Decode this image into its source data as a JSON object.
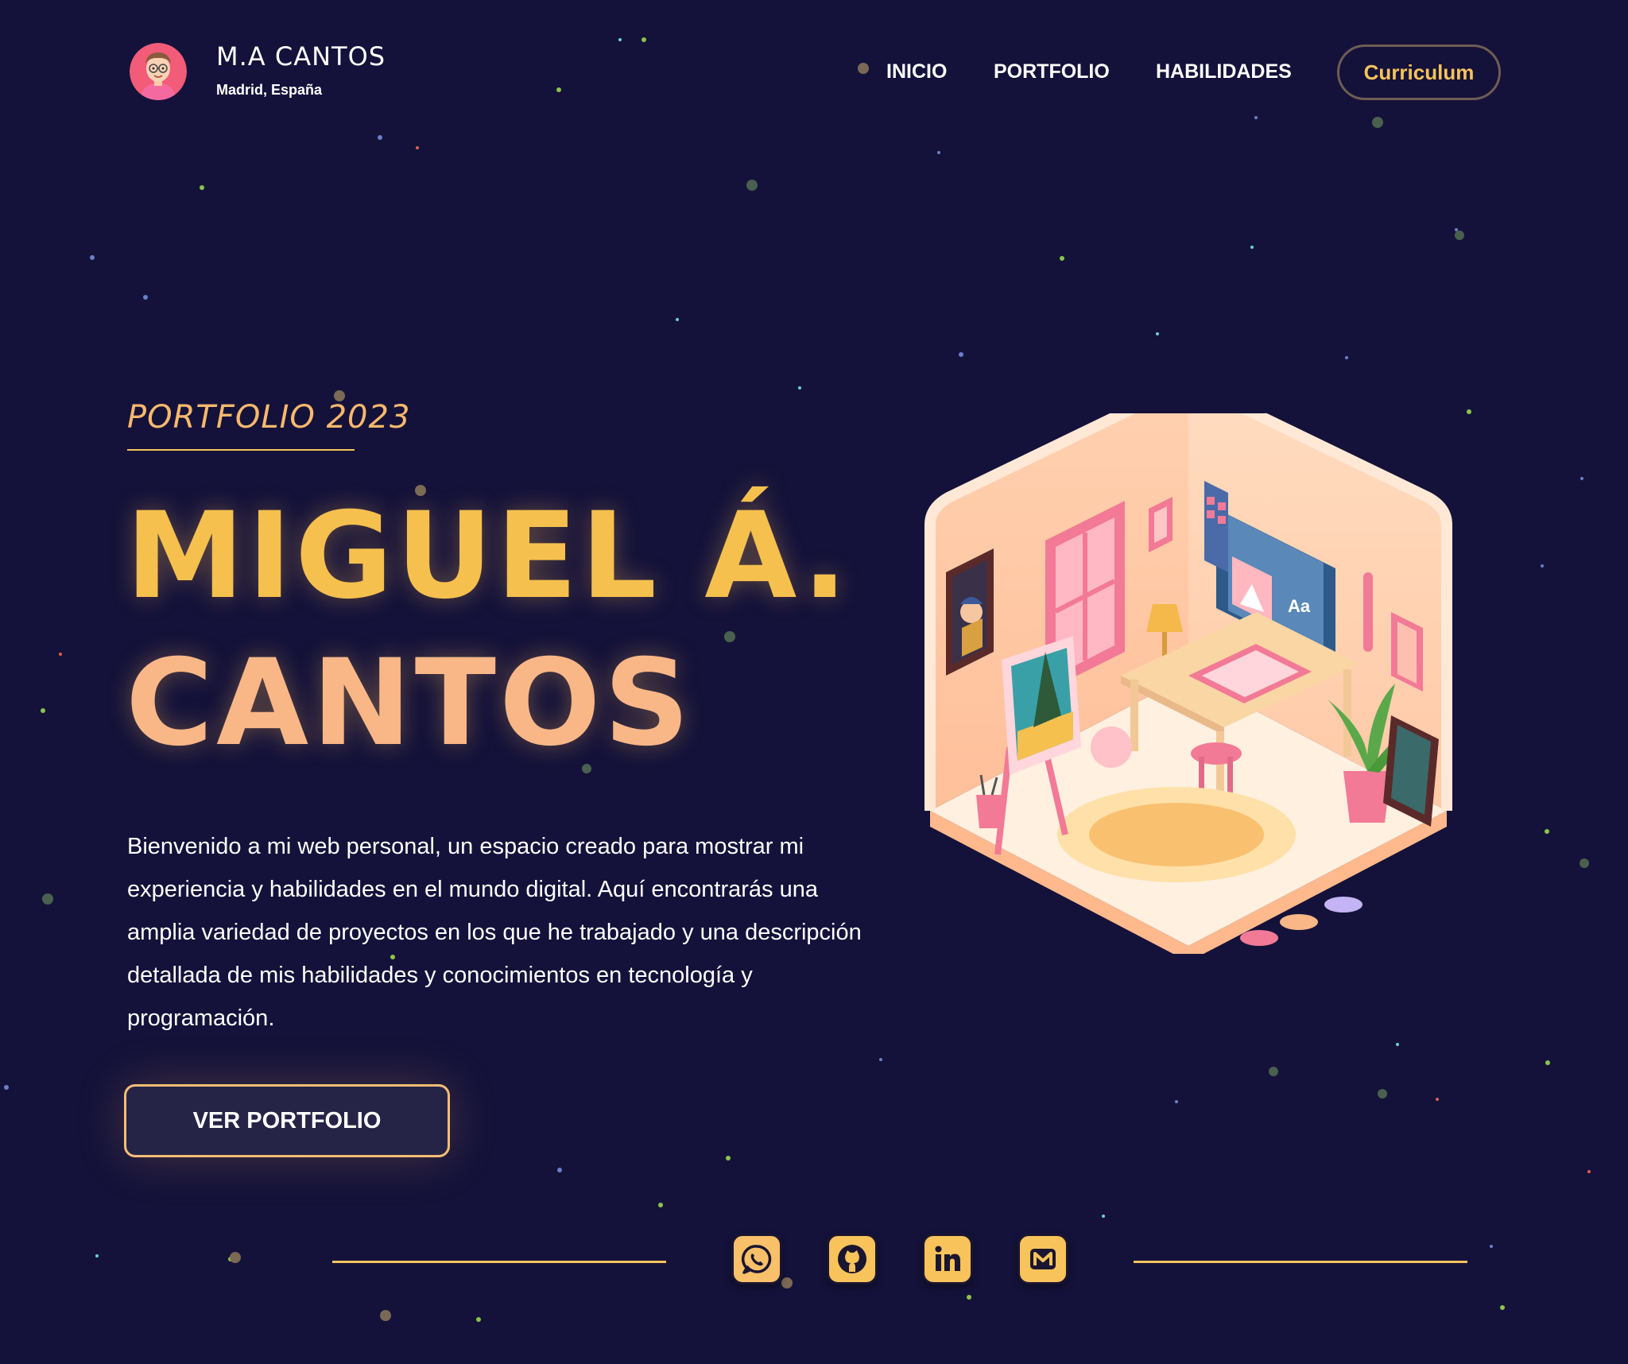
{
  "header": {
    "brand_name": "M.A CANTOS",
    "location": "Madrid, España",
    "nav": [
      "INICIO",
      "PORTFOLIO",
      "HABILIDADES"
    ],
    "cv_label": "Curriculum"
  },
  "hero": {
    "eyebrow": "PORTFOLIO 2023",
    "name_line1": "MIGUEL Á.",
    "name_line2": "CANTOS",
    "intro": "Bienvenido a mi web personal, un espacio creado para mostrar mi experiencia y habilidades en el mundo digital. Aquí encontrarás una amplia variedad de proyectos en los que he trabajado y una descripción detallada de mis habilidades y conocimientos en tecnología y programación.",
    "cta_label": "VER PORTFOLIO"
  },
  "illustration": {
    "tile_label": "Aa"
  },
  "socials": [
    {
      "icon": "whatsapp-icon"
    },
    {
      "icon": "github-icon"
    },
    {
      "icon": "linkedin-icon"
    },
    {
      "icon": "mail-icon"
    }
  ],
  "colors": {
    "background": "#14123a",
    "accent_yellow": "#f5c04e",
    "accent_peach": "#f9b787",
    "button_bg": "#252447"
  }
}
